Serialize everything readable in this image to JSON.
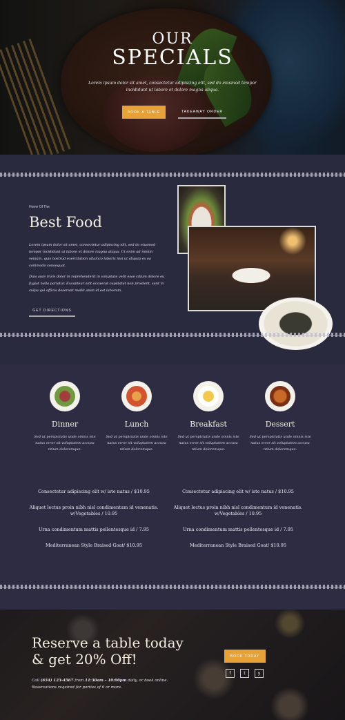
{
  "hero": {
    "title_line1": "OUR",
    "title_line2": "SPECIALS",
    "lede": "Lorem ipsum dolor sit amet, consectetur adipiscing elit, sed do eiusmod tempor incididunt ut labore et dolore magna aliqua.",
    "book_label": "BOOK A TABLE",
    "takeaway_label": "TAKEAWAY ORDER"
  },
  "about": {
    "kicker": "Home Of The",
    "title": "Best Food",
    "para1": "Lorem ipsum dolor sit amet, consectetur adipiscing elit, sed do eiusmod tempor incididunt ut labore et dolore magna aliqua. Ut enim ad minim veniam, quis nostrud exercitation ullamco laboris nisi ut aliquip ex ea commodo consequat.",
    "para2": "Duis aute irure dolor in reprehenderit in voluptate velit esse cillum dolore eu fugiat nulla pariatur. Excepteur sint occaecat cupidatat non proident, sunt in culpa qui officia deserunt mollit anim id est laborum.",
    "directions_label": "GET DIRECTIONS"
  },
  "menu": {
    "categories": [
      {
        "name": "Dinner",
        "desc": "Sed ut perspiciatis unde omnis iste natus error sit voluptatem accusa ntium doloremque.",
        "icon": "salad-plate-icon",
        "color": "#7a9a4a"
      },
      {
        "name": "Lunch",
        "desc": "Sed ut perspiciatis unde omnis iste natus error sit voluptatem accusa ntium doloremque.",
        "icon": "pizza-plate-icon",
        "color": "#d1532f"
      },
      {
        "name": "Breakfast",
        "desc": "Sed ut perspiciatis unde omnis iste natus error sit voluptatem accusa ntium doloremque.",
        "icon": "egg-plate-icon",
        "color": "#f2c94c"
      },
      {
        "name": "Dessert",
        "desc": "Sed ut perspiciatis unde omnis iste natus error sit voluptatem accusa ntium doloremque.",
        "icon": "dessert-plate-icon",
        "color": "#a3461f"
      }
    ],
    "items_left": [
      "Consectetur adipiscing elit w/ iste natus / $10.95",
      "Aliquet lectus proin nibh nisl condimentum id venenatis. w/Vegetables / 10.95",
      "Urna condimentum mattis pellentesque id / 7.95",
      "Mediterranean Style Braised Goat/ $10.95"
    ],
    "items_right": [
      "Consectetur adipiscing elit w/ iste natus / $10.95",
      "Aliquet lectus proin nibh nisl condimentum id venenatis. w/Vegetables / 10.95",
      "Urna condimentum mattis pellentesque id / 7.95",
      "Mediterranean Style Braised Goat/ $10.95"
    ]
  },
  "reserve": {
    "title_line1": "Reserve a table today",
    "title_line2": "& get 20% Off!",
    "call_prefix": "Call",
    "phone": "(654) 123-4567",
    "from_text": "from",
    "hours": "11:30am – 10:00pm",
    "hours_suffix": "daily, or book online.",
    "note": "Reservations required for parties of 6 or more.",
    "book_label": "BOOK TODAY",
    "social": [
      {
        "icon": "facebook-icon",
        "glyph": "f"
      },
      {
        "icon": "twitter-icon",
        "glyph": "t"
      },
      {
        "icon": "yelp-icon",
        "glyph": "y"
      }
    ]
  },
  "colors": {
    "accent": "#e6a137",
    "section_bg": "#2a2a3e",
    "cream_text": "#f5f0e6"
  }
}
